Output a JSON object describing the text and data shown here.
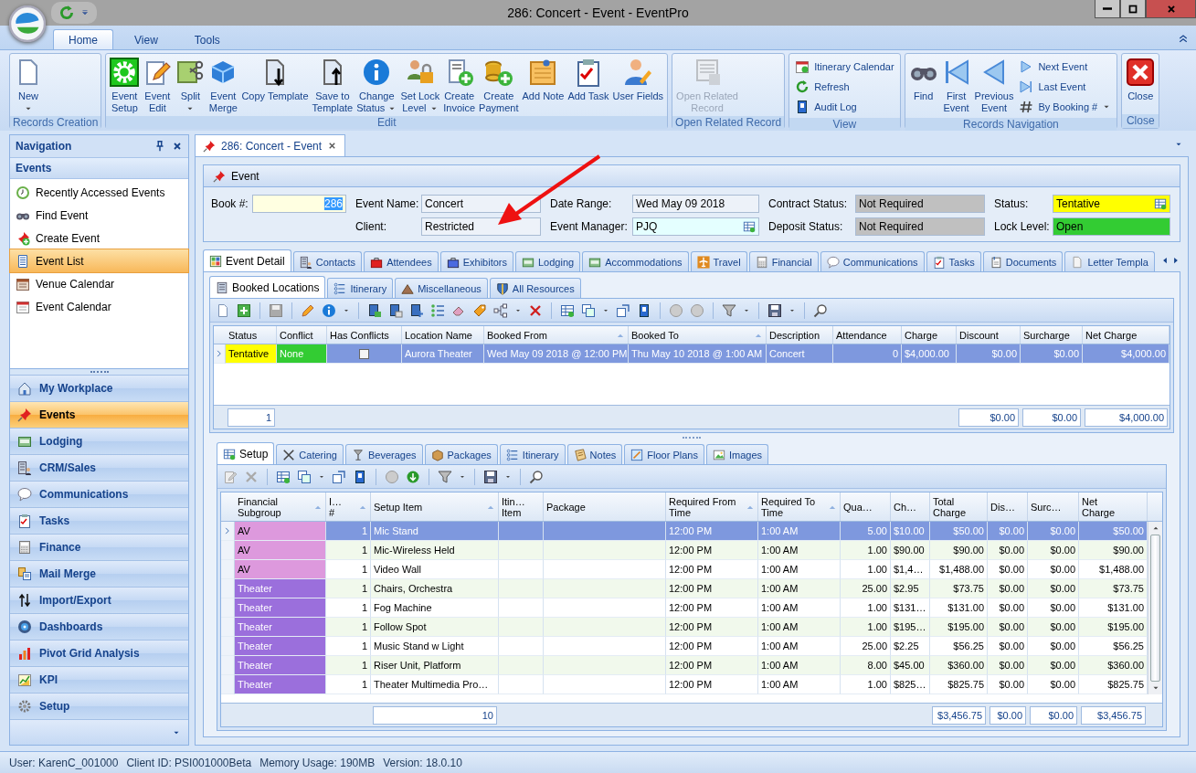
{
  "window": {
    "title": "286: Concert - Event - EventPro"
  },
  "ribbon": {
    "tabs": [
      {
        "label": "Home",
        "selected": true
      },
      {
        "label": "View",
        "selected": false
      },
      {
        "label": "Tools",
        "selected": false
      }
    ],
    "groups": [
      {
        "label": "Records Creation",
        "buttons": [
          {
            "label": "New",
            "kind": "large",
            "dropdown": true,
            "disabled": false
          }
        ]
      },
      {
        "label": "Edit",
        "buttons": [
          {
            "label": "Event\nSetup",
            "kind": "large",
            "dropdown": false,
            "disabled": false
          },
          {
            "label": "Event\nEdit",
            "kind": "large",
            "dropdown": false,
            "disabled": false
          },
          {
            "label": "Split",
            "kind": "large",
            "dropdown": true,
            "disabled": false
          },
          {
            "label": "Event\nMerge",
            "kind": "large",
            "dropdown": false,
            "disabled": false
          },
          {
            "label": "Copy Template",
            "kind": "large",
            "dropdown": false,
            "disabled": false
          },
          {
            "label": "Save to\nTemplate",
            "kind": "large",
            "dropdown": false,
            "disabled": false
          },
          {
            "label": "Change\nStatus",
            "kind": "large",
            "dropdown": true,
            "disabled": false
          },
          {
            "label": "Set Lock\nLevel",
            "kind": "large",
            "dropdown": true,
            "disabled": false
          },
          {
            "label": "Create\nInvoice",
            "kind": "large",
            "dropdown": false,
            "disabled": false
          },
          {
            "label": "Create\nPayment",
            "kind": "large",
            "dropdown": false,
            "disabled": false
          },
          {
            "label": "Add Note",
            "kind": "large",
            "dropdown": false,
            "disabled": false
          },
          {
            "label": "Add Task",
            "kind": "large",
            "dropdown": false,
            "disabled": false
          },
          {
            "label": "User Fields",
            "kind": "large",
            "dropdown": false,
            "disabled": false
          }
        ]
      },
      {
        "label": "Open Related Record",
        "buttons": [
          {
            "label": "Open Related\nRecord",
            "kind": "large",
            "dropdown": false,
            "disabled": true
          }
        ]
      },
      {
        "label": "View",
        "buttons": [
          {
            "label": "Itinerary Calendar",
            "kind": "small",
            "dropdown": false,
            "disabled": false
          },
          {
            "label": "Refresh",
            "kind": "small",
            "dropdown": false,
            "disabled": false
          },
          {
            "label": "Audit Log",
            "kind": "small",
            "dropdown": false,
            "disabled": false
          }
        ]
      },
      {
        "label": "Records Navigation",
        "buttons": [
          {
            "label": "Find",
            "kind": "large",
            "dropdown": false,
            "disabled": false
          },
          {
            "label": "First\nEvent",
            "kind": "large",
            "dropdown": false,
            "disabled": false
          },
          {
            "label": "Previous\nEvent",
            "kind": "large",
            "dropdown": false,
            "disabled": false
          },
          {
            "label": "Next Event",
            "kind": "small",
            "dropdown": false,
            "disabled": false
          },
          {
            "label": "Last Event",
            "kind": "small",
            "dropdown": false,
            "disabled": false
          },
          {
            "label": "By Booking #",
            "kind": "small",
            "dropdown": true,
            "disabled": false
          }
        ]
      },
      {
        "label": "Close",
        "buttons": [
          {
            "label": "Close",
            "kind": "large",
            "dropdown": false,
            "disabled": false
          }
        ]
      }
    ]
  },
  "navigation": {
    "title": "Navigation",
    "section": "Events",
    "items": [
      {
        "label": "Recently Accessed Events",
        "selected": false
      },
      {
        "label": "Find Event",
        "selected": false
      },
      {
        "label": "Create Event",
        "selected": false
      },
      {
        "label": "Event List",
        "selected": true
      },
      {
        "label": "Venue Calendar",
        "selected": false
      },
      {
        "label": "Event Calendar",
        "selected": false
      }
    ],
    "modules": [
      {
        "label": "My Workplace",
        "selected": false
      },
      {
        "label": "Events",
        "selected": true
      },
      {
        "label": "Lodging",
        "selected": false
      },
      {
        "label": "CRM/Sales",
        "selected": false
      },
      {
        "label": "Communications",
        "selected": false
      },
      {
        "label": "Tasks",
        "selected": false
      },
      {
        "label": "Finance",
        "selected": false
      },
      {
        "label": "Mail Merge",
        "selected": false
      },
      {
        "label": "Import/Export",
        "selected": false
      },
      {
        "label": "Dashboards",
        "selected": false
      },
      {
        "label": "Pivot Grid Analysis",
        "selected": false
      },
      {
        "label": "KPI",
        "selected": false
      },
      {
        "label": "Setup",
        "selected": false
      }
    ]
  },
  "document_tab": {
    "label": "286: Concert - Event"
  },
  "event": {
    "title": "Event",
    "columns": [
      [
        {
          "label": "Book #:",
          "value": "286",
          "color": "#ffffe1",
          "lookup": false,
          "text_selected": true
        }
      ],
      [
        {
          "label": "Event Name:",
          "value": "Concert",
          "color": "#edf2f9",
          "lookup": false,
          "text_selected": false
        },
        {
          "label": "Client:",
          "value": "Restricted",
          "color": "#edf2f9",
          "lookup": false,
          "text_selected": false
        }
      ],
      [
        {
          "label": "Date Range:",
          "value": "Wed May 09 2018",
          "color": "#edf2f9",
          "lookup": false,
          "text_selected": false
        },
        {
          "label": "Event Manager:",
          "value": "PJQ",
          "color": "#e4ffff",
          "lookup": true,
          "text_selected": false
        }
      ],
      [
        {
          "label": "Contract Status:",
          "value": "Not Required",
          "color": "#c0c0c0",
          "lookup": false,
          "text_selected": false
        },
        {
          "label": "Deposit Status:",
          "value": "Not Required",
          "color": "#c0c0c0",
          "lookup": false,
          "text_selected": false
        }
      ],
      [
        {
          "label": "Status:",
          "value": "Tentative",
          "color": "#ffff00",
          "lookup": true,
          "text_selected": false
        },
        {
          "label": "Lock Level:",
          "value": "Open",
          "color": "#33cc33",
          "lookup": false,
          "text_selected": false
        }
      ]
    ]
  },
  "detail_tabs": [
    {
      "label": "Event Detail",
      "selected": true
    },
    {
      "label": "Contacts",
      "selected": false
    },
    {
      "label": "Attendees",
      "selected": false
    },
    {
      "label": "Exhibitors",
      "selected": false
    },
    {
      "label": "Lodging",
      "selected": false
    },
    {
      "label": "Accommodations",
      "selected": false
    },
    {
      "label": "Travel",
      "selected": false
    },
    {
      "label": "Financial",
      "selected": false
    },
    {
      "label": "Communications",
      "selected": false
    },
    {
      "label": "Tasks",
      "selected": false
    },
    {
      "label": "Documents",
      "selected": false
    },
    {
      "label": "Letter Templa",
      "selected": false
    }
  ],
  "locations": {
    "tabs": [
      {
        "label": "Booked Locations",
        "selected": true
      },
      {
        "label": "Itinerary",
        "selected": false
      },
      {
        "label": "Miscellaneous",
        "selected": false
      },
      {
        "label": "All Resources",
        "selected": false
      }
    ],
    "grid": {
      "columns": [
        {
          "label": "Status",
          "sorted": false,
          "total": "1"
        },
        {
          "label": "Conflict",
          "sorted": false
        },
        {
          "label": "Has Conflicts",
          "sorted": false
        },
        {
          "label": "Location Name",
          "sorted": false
        },
        {
          "label": "Booked From",
          "sorted": true
        },
        {
          "label": "Booked To",
          "sorted": true
        },
        {
          "label": "Description",
          "sorted": false
        },
        {
          "label": "Attendance",
          "sorted": false
        },
        {
          "label": "Charge",
          "sorted": false
        },
        {
          "label": "Discount",
          "sorted": false,
          "total": "$0.00"
        },
        {
          "label": "Surcharge",
          "sorted": false,
          "total": "$0.00"
        },
        {
          "label": "Net Charge",
          "sorted": false,
          "total": "$4,000.00"
        }
      ],
      "rows": [
        {
          "selected": true,
          "cells": [
            {
              "text": "Tentative",
              "color": "#ffff00"
            },
            {
              "text": "None",
              "color": "#33cc33"
            },
            {
              "checked": false
            },
            "Aurora Theater",
            "Wed May 09 2018 @ 12:00 PM",
            "Thu May 10 2018 @ 1:00 AM",
            "Concert",
            "0",
            "$4,000.00",
            "$0.00",
            "$0.00",
            "$4,000.00"
          ]
        }
      ]
    }
  },
  "setup": {
    "tabs": [
      {
        "label": "Setup",
        "selected": true
      },
      {
        "label": "Catering",
        "selected": false
      },
      {
        "label": "Beverages",
        "selected": false
      },
      {
        "label": "Packages",
        "selected": false
      },
      {
        "label": "Itinerary",
        "selected": false
      },
      {
        "label": "Notes",
        "selected": false
      },
      {
        "label": "Floor Plans",
        "selected": false
      },
      {
        "label": "Images",
        "selected": false
      }
    ],
    "grid": {
      "columns": [
        {
          "label": "Financial\nSubgroup",
          "sorted": true
        },
        {
          "label": "I…\n#",
          "sorted": true
        },
        {
          "label": "Setup Item",
          "sorted": true,
          "total": "10"
        },
        {
          "label": "Itin…\nItem",
          "sorted": false
        },
        {
          "label": "Package",
          "sorted": false
        },
        {
          "label": "Required From\nTime",
          "sorted": true
        },
        {
          "label": "Required To\nTime",
          "sorted": true
        },
        {
          "label": "Qua…",
          "sorted": false
        },
        {
          "label": "Ch…",
          "sorted": false
        },
        {
          "label": "Total\nCharge",
          "sorted": false,
          "total": "$3,456.75"
        },
        {
          "label": "Dis…",
          "sorted": false,
          "total": "$0.00"
        },
        {
          "label": "Surc…",
          "sorted": false,
          "total": "$0.00"
        },
        {
          "label": "Net\nCharge",
          "sorted": false,
          "total": "$3,456.75"
        }
      ],
      "rows": [
        {
          "selected": true,
          "cells": [
            {
              "text": "AV",
              "color": "#dd99dd"
            },
            "1",
            "Mic Stand",
            null,
            null,
            "12:00 PM",
            "1:00 AM",
            "5.00",
            "$10.00",
            "$50.00",
            "$0.00",
            "$0.00",
            "$50.00"
          ]
        },
        {
          "selected": false,
          "cells": [
            {
              "text": "AV",
              "color": "#dd99dd"
            },
            "1",
            "Mic-Wireless Held",
            null,
            null,
            "12:00 PM",
            "1:00 AM",
            "1.00",
            "$90.00",
            "$90.00",
            "$0.00",
            "$0.00",
            "$90.00"
          ]
        },
        {
          "selected": false,
          "cells": [
            {
              "text": "AV",
              "color": "#dd99dd"
            },
            "1",
            "Video Wall",
            null,
            null,
            "12:00 PM",
            "1:00 AM",
            "1.00",
            "$1,4…",
            "$1,488.00",
            "$0.00",
            "$0.00",
            "$1,488.00"
          ]
        },
        {
          "selected": false,
          "cells": [
            {
              "text": "Theater",
              "color": "#9b6fdc"
            },
            "1",
            "Chairs, Orchestra",
            null,
            null,
            "12:00 PM",
            "1:00 AM",
            "25.00",
            "$2.95",
            "$73.75",
            "$0.00",
            "$0.00",
            "$73.75"
          ]
        },
        {
          "selected": false,
          "cells": [
            {
              "text": "Theater",
              "color": "#9b6fdc"
            },
            "1",
            "Fog Machine",
            null,
            null,
            "12:00 PM",
            "1:00 AM",
            "1.00",
            "$131…",
            "$131.00",
            "$0.00",
            "$0.00",
            "$131.00"
          ]
        },
        {
          "selected": false,
          "cells": [
            {
              "text": "Theater",
              "color": "#9b6fdc"
            },
            "1",
            "Follow Spot",
            null,
            null,
            "12:00 PM",
            "1:00 AM",
            "1.00",
            "$195…",
            "$195.00",
            "$0.00",
            "$0.00",
            "$195.00"
          ]
        },
        {
          "selected": false,
          "cells": [
            {
              "text": "Theater",
              "color": "#9b6fdc"
            },
            "1",
            "Music Stand w Light",
            null,
            null,
            "12:00 PM",
            "1:00 AM",
            "25.00",
            "$2.25",
            "$56.25",
            "$0.00",
            "$0.00",
            "$56.25"
          ]
        },
        {
          "selected": false,
          "cells": [
            {
              "text": "Theater",
              "color": "#9b6fdc"
            },
            "1",
            "Riser Unit, Platform",
            null,
            null,
            "12:00 PM",
            "1:00 AM",
            "8.00",
            "$45.00",
            "$360.00",
            "$0.00",
            "$0.00",
            "$360.00"
          ]
        },
        {
          "selected": false,
          "cells": [
            {
              "text": "Theater",
              "color": "#9b6fdc"
            },
            "1",
            "Theater Multimedia Pro…",
            null,
            null,
            "12:00 PM",
            "1:00 AM",
            "1.00",
            "$825…",
            "$825.75",
            "$0.00",
            "$0.00",
            "$825.75"
          ]
        }
      ]
    }
  },
  "status_bar": {
    "items": [
      "User: KarenC_001000",
      "Client ID: PSI001000Beta",
      "Memory Usage: 190MB",
      "Version: 18.0.10"
    ]
  }
}
